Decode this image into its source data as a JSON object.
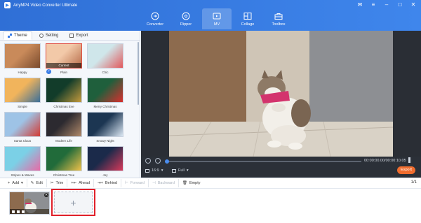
{
  "app": {
    "title": "AnyMP4 Video Converter Ultimate"
  },
  "window_controls": {
    "feedback": "✉",
    "menu": "≡",
    "minimize": "–",
    "maximize": "□",
    "close": "✕"
  },
  "nav": {
    "items": [
      {
        "label": "Converter",
        "icon": "converter-icon",
        "active": false
      },
      {
        "label": "Ripper",
        "icon": "ripper-icon",
        "active": false
      },
      {
        "label": "MV",
        "icon": "mv-icon",
        "active": true
      },
      {
        "label": "Collage",
        "icon": "collage-icon",
        "active": false
      },
      {
        "label": "Toolbox",
        "icon": "toolbox-icon",
        "active": false
      }
    ]
  },
  "left_tabs": [
    {
      "label": "Theme",
      "active": true
    },
    {
      "label": "Setting",
      "active": false
    },
    {
      "label": "Export",
      "active": false
    }
  ],
  "themes": [
    {
      "label": "Happy",
      "colors": [
        "#c98a5a",
        "#7a4b2e"
      ]
    },
    {
      "label": "Plain",
      "colors": [
        "#f2c9a8",
        "#b56a48"
      ],
      "current": true,
      "current_label": "Current"
    },
    {
      "label": "Chic",
      "colors": [
        "#cfe6ea",
        "#e2595c"
      ]
    },
    {
      "label": "Simple",
      "colors": [
        "#f1b45c",
        "#3b6f9a"
      ]
    },
    {
      "label": "Christmas Eve",
      "colors": [
        "#123c2a",
        "#c59b3d"
      ]
    },
    {
      "label": "Merry Christmas",
      "colors": [
        "#1f5f3c",
        "#d8302e"
      ]
    },
    {
      "label": "Santa Claus",
      "colors": [
        "#9ec3e6",
        "#d33a33"
      ]
    },
    {
      "label": "Modern Life",
      "colors": [
        "#2c2a30",
        "#b18a6a"
      ]
    },
    {
      "label": "Snowy Night",
      "colors": [
        "#1c3652",
        "#dbe7f3"
      ]
    },
    {
      "label": "Stripes & Waves",
      "colors": [
        "#7bd0e6",
        "#e86aa6"
      ]
    },
    {
      "label": "Christmas Tree",
      "colors": [
        "#216b3a",
        "#f0c24a"
      ]
    },
    {
      "label": "Joy",
      "colors": [
        "#1b2a4a",
        "#d8395a"
      ]
    }
  ],
  "player": {
    "time": "00:00:00.00/00:00:10.05",
    "ratio": "16:9",
    "zoom": "Full",
    "export_label": "Export",
    "progress": 0
  },
  "toolbar": {
    "items": [
      {
        "label": "Add",
        "icon": "plus-icon",
        "enabled": true,
        "dropdown": true
      },
      {
        "label": "Edit",
        "icon": "edit-icon",
        "enabled": true
      },
      {
        "label": "Trim",
        "icon": "scissors-icon",
        "enabled": true
      },
      {
        "label": "Ahead",
        "icon": "ahead-icon",
        "enabled": true
      },
      {
        "label": "Behind",
        "icon": "behind-icon",
        "enabled": true
      },
      {
        "label": "Forward",
        "icon": "forward-icon",
        "enabled": false
      },
      {
        "label": "Backward",
        "icon": "backward-icon",
        "enabled": false
      },
      {
        "label": "Empty",
        "icon": "trash-icon",
        "enabled": true
      }
    ],
    "pager": "1/1"
  },
  "timeline": {
    "add_symbol": "+"
  },
  "colors": {
    "accent": "#3a7de6",
    "export": "#f06d2f",
    "highlight": "#e0202a"
  }
}
